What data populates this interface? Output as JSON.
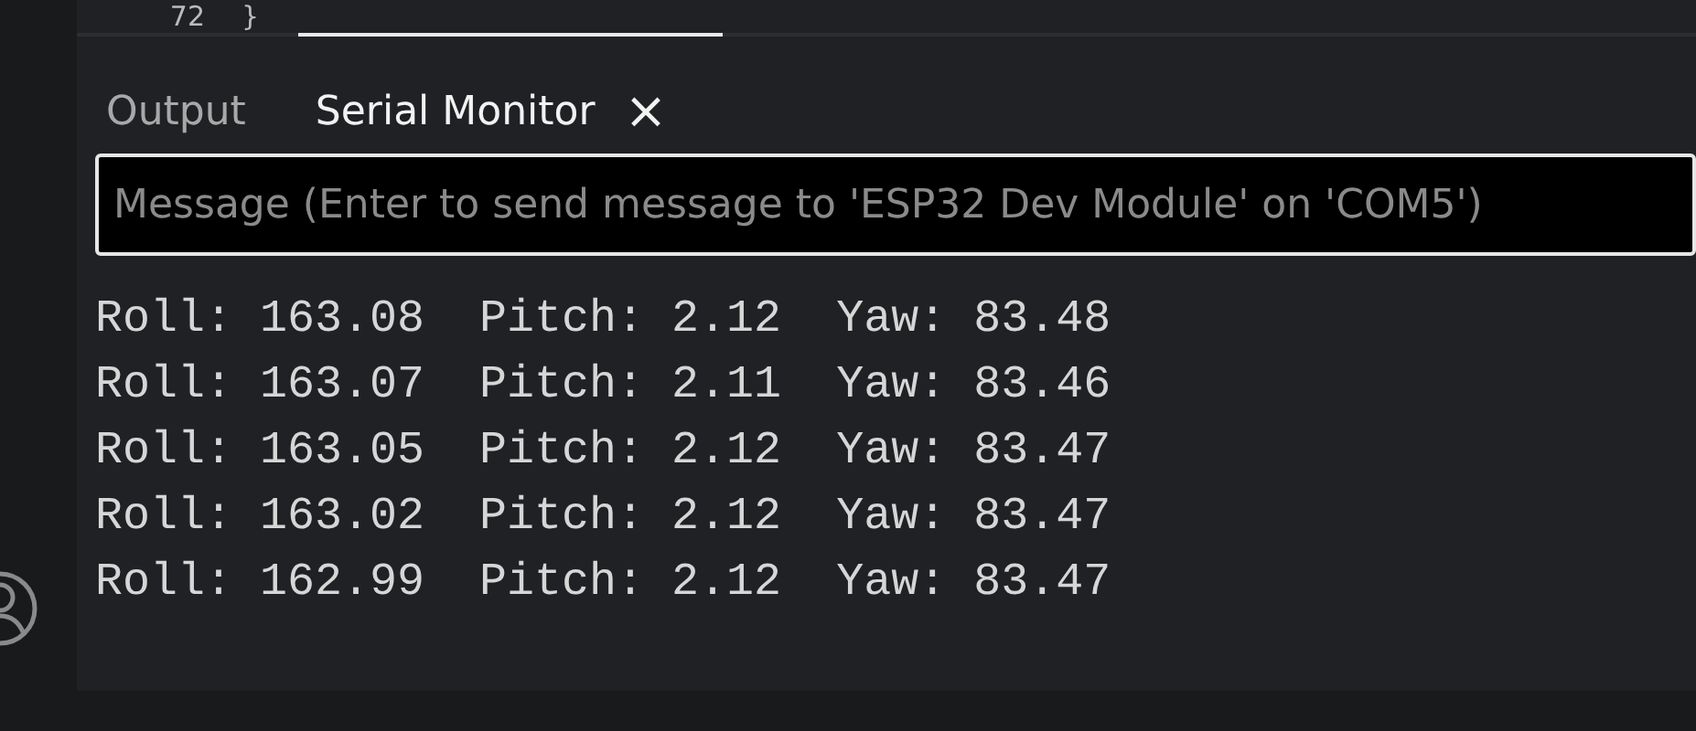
{
  "editor": {
    "line_number": "72",
    "code": "}"
  },
  "tabs": [
    {
      "label": "Output",
      "selected": false,
      "closable": false
    },
    {
      "label": "Serial Monitor",
      "selected": true,
      "closable": true,
      "close": "×"
    }
  ],
  "message_field": {
    "placeholder": "Message (Enter to send message to 'ESP32 Dev Module' on 'COM5')"
  },
  "output_lines": [
    "Roll: 163.08  Pitch: 2.12  Yaw: 83.48",
    "Roll: 163.07  Pitch: 2.11  Yaw: 83.46",
    "Roll: 163.05  Pitch: 2.12  Yaw: 83.47",
    "Roll: 163.02  Pitch: 2.12  Yaw: 83.47",
    "Roll: 162.99  Pitch: 2.12  Yaw: 83.47"
  ]
}
